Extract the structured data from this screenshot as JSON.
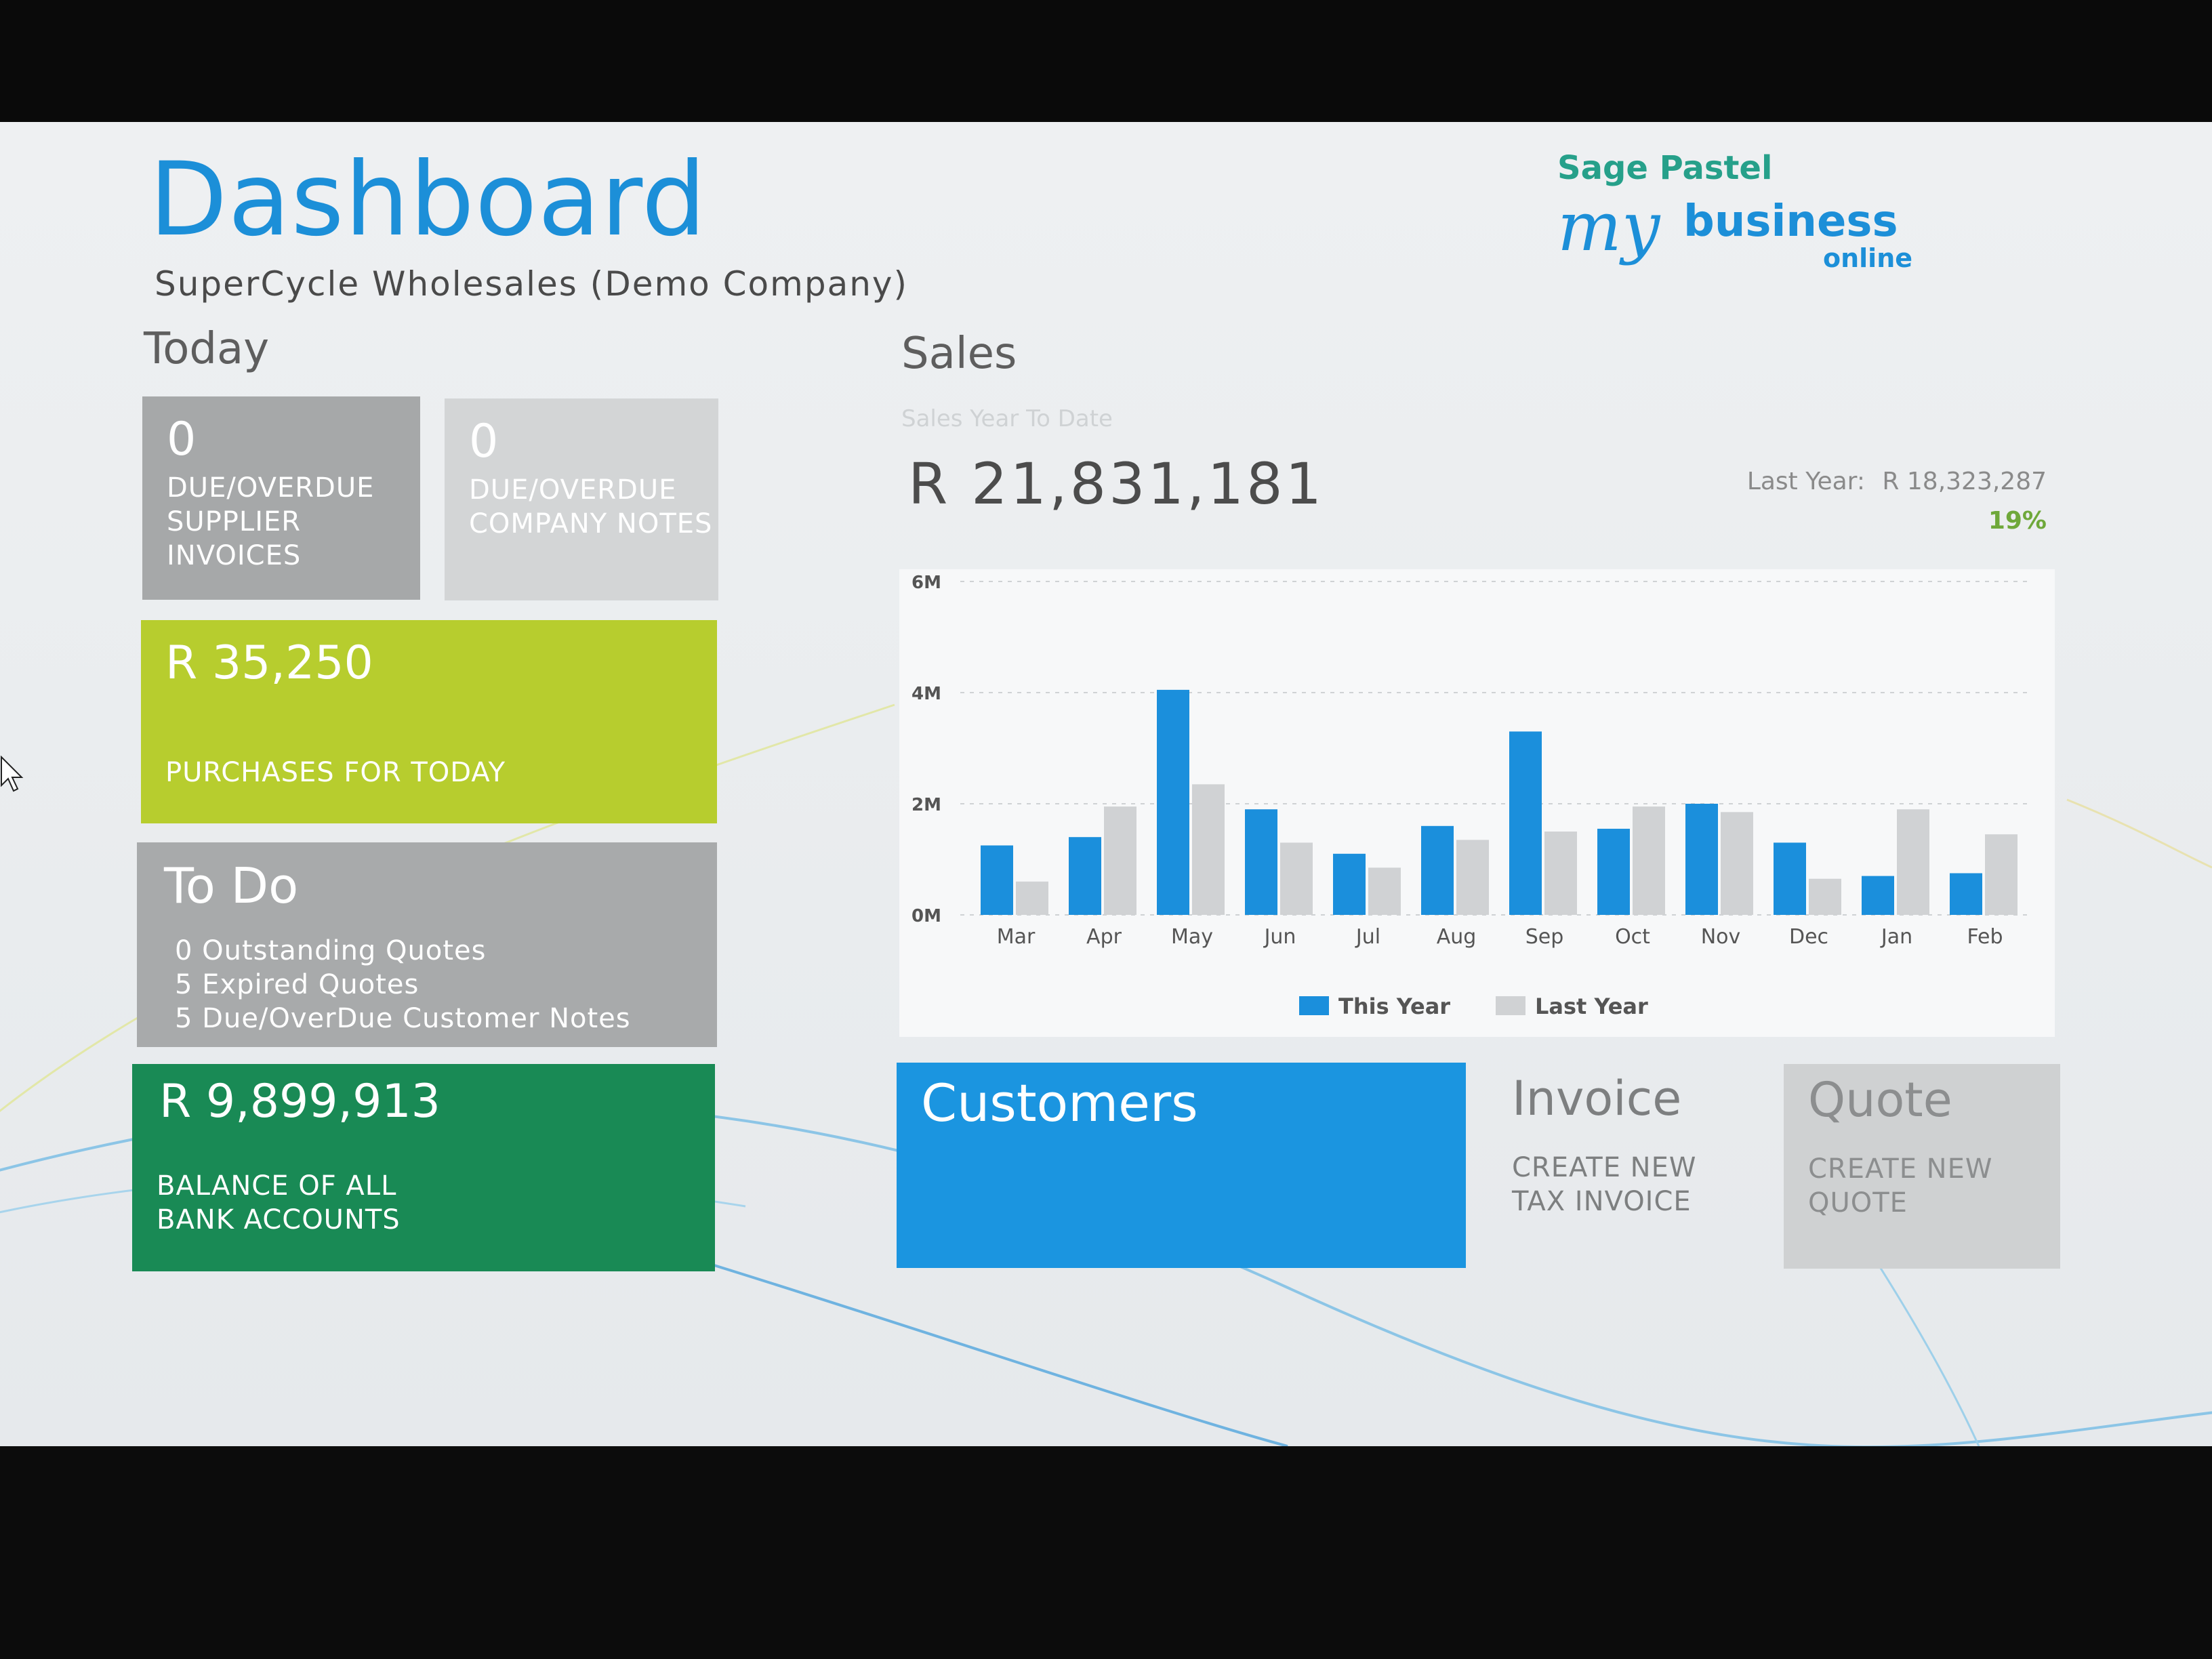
{
  "header": {
    "title": "Dashboard",
    "company": "SuperCycle Wholesales (Demo Company)"
  },
  "logo": {
    "brand": "Sage Pastel",
    "my": "my",
    "business": "business",
    "online": "online"
  },
  "today": {
    "heading": "Today",
    "supplier_invoices": {
      "count": "0",
      "label": "DUE/OVERDUE SUPPLIER INVOICES"
    },
    "company_notes": {
      "count": "0",
      "label": "DUE/OVERDUE COMPANY NOTES"
    },
    "purchases": {
      "amount": "R 35,250",
      "label": "PURCHASES FOR TODAY"
    },
    "todo": {
      "title": "To Do",
      "items": [
        "0 Outstanding Quotes",
        "5 Expired Quotes",
        "5 Due/OverDue Customer Notes"
      ]
    },
    "bank": {
      "amount": "R 9,899,913",
      "label_line1": "BALANCE OF ALL",
      "label_line2": "BANK ACCOUNTS"
    }
  },
  "sales": {
    "heading": "Sales",
    "ytd_label": "Sales Year To Date",
    "ytd_total": "R 21,831,181",
    "last_year_label": "Last Year:",
    "last_year_value": "R 18,323,287",
    "change_pct": "19%"
  },
  "actions": {
    "customers": "Customers",
    "invoice": {
      "title": "Invoice",
      "line1": "CREATE NEW",
      "line2": "TAX INVOICE"
    },
    "quote": {
      "title": "Quote",
      "line1": "CREATE NEW",
      "line2": "QUOTE"
    }
  },
  "colors": {
    "accent_blue": "#1b95e0",
    "lime": "#b7cd2e",
    "green": "#198a55",
    "grey": "#a8aaab",
    "last_year_bar": "#d0d2d4"
  },
  "chart_data": {
    "type": "bar",
    "categories": [
      "Mar",
      "Apr",
      "May",
      "Jun",
      "Jul",
      "Aug",
      "Sep",
      "Oct",
      "Nov",
      "Dec",
      "Jan",
      "Feb"
    ],
    "series": [
      {
        "name": "This Year",
        "values": [
          1.25,
          1.4,
          4.05,
          1.9,
          1.1,
          1.6,
          3.3,
          1.55,
          2.0,
          1.3,
          0.7,
          0.75
        ],
        "color": "#1b8fdc"
      },
      {
        "name": "Last Year",
        "values": [
          0.6,
          1.95,
          2.35,
          1.3,
          0.85,
          1.35,
          1.5,
          1.95,
          1.85,
          0.65,
          1.9,
          1.45
        ],
        "color": "#d0d2d4"
      }
    ],
    "y_ticks": [
      "0M",
      "2M",
      "4M",
      "6M"
    ],
    "ylim": [
      0,
      6
    ],
    "grid": true,
    "legend": "bottom-center"
  }
}
